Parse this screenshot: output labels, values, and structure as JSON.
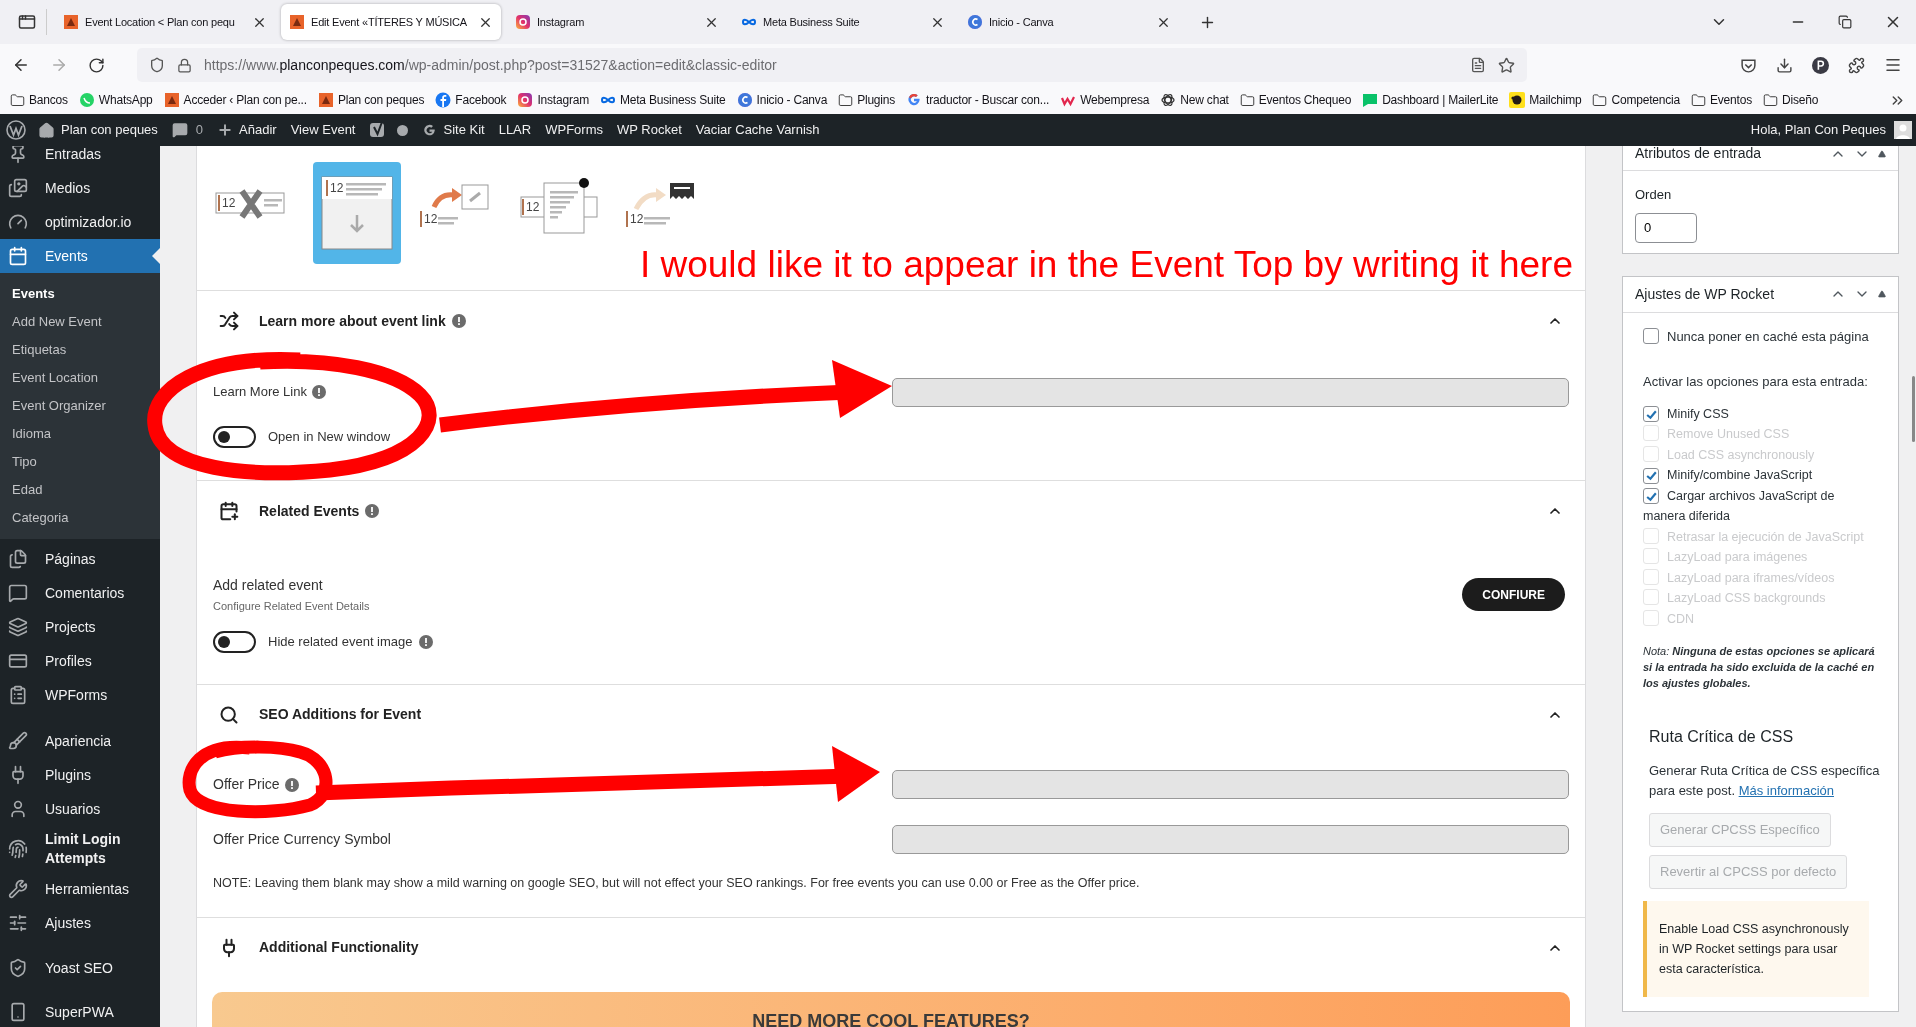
{
  "browser": {
    "tabs": [
      {
        "title": "Event Location < Plan con pequ",
        "kind": "site",
        "selected": false
      },
      {
        "title": "Edit Event «TÍTERES Y MÚSICA",
        "kind": "site",
        "selected": true
      },
      {
        "title": "Instagram",
        "kind": "instagram",
        "selected": false
      },
      {
        "title": "Meta Business Suite",
        "kind": "meta",
        "selected": false
      },
      {
        "title": "Inicio - Canva",
        "kind": "canva",
        "selected": false
      }
    ],
    "url": {
      "scheme": "https://www.",
      "domain": "planconpeques.com",
      "path": "/wp-admin/post.php?post=31527&action=edit&classic-editor"
    },
    "bookmarks": [
      {
        "label": "Bancos",
        "kind": "folder"
      },
      {
        "label": "WhatsApp",
        "kind": "whatsapp"
      },
      {
        "label": "Acceder ‹ Plan con pe...",
        "kind": "site"
      },
      {
        "label": "Plan con peques",
        "kind": "site"
      },
      {
        "label": "Facebook",
        "kind": "facebook"
      },
      {
        "label": "Instagram",
        "kind": "instagram"
      },
      {
        "label": "Meta Business Suite",
        "kind": "meta"
      },
      {
        "label": "Inicio - Canva",
        "kind": "canva"
      },
      {
        "label": "Plugins",
        "kind": "folder"
      },
      {
        "label": "traductor - Buscar con...",
        "kind": "google"
      },
      {
        "label": "Webempresa",
        "kind": "webempresa"
      },
      {
        "label": "New chat",
        "kind": "chat"
      },
      {
        "label": "Eventos Chequeo",
        "kind": "folder"
      },
      {
        "label": "Dashboard | MailerLite",
        "kind": "mailerlite"
      },
      {
        "label": "Mailchimp",
        "kind": "mailchimp"
      },
      {
        "label": "Competencia",
        "kind": "folder"
      },
      {
        "label": "Eventos",
        "kind": "folder"
      },
      {
        "label": "Diseño",
        "kind": "folder"
      }
    ]
  },
  "admin_bar": {
    "items": [
      {
        "kind": "home",
        "label": "Plan con peques"
      },
      {
        "kind": "comments",
        "label": "0"
      },
      {
        "kind": "add",
        "label": "Añadir"
      },
      {
        "kind": "text",
        "label": "View Event"
      },
      {
        "kind": "yoast"
      },
      {
        "kind": "dot"
      },
      {
        "kind": "google",
        "label": "Site Kit"
      },
      {
        "kind": "text",
        "label": "LLAR"
      },
      {
        "kind": "text",
        "label": "WPForms"
      },
      {
        "kind": "text",
        "label": "WP Rocket"
      },
      {
        "kind": "text",
        "label": "Vaciar Cache Varnish"
      }
    ],
    "greeting": "Hola, Plan Con Peques"
  },
  "sidebar": {
    "items": [
      {
        "label": "Entradas",
        "selected": false
      },
      {
        "label": "Medios",
        "selected": false
      },
      {
        "label": "optimizador.io",
        "selected": false
      },
      {
        "label": "Events",
        "selected": true,
        "children": [
          {
            "label": "Events",
            "selected": true
          },
          {
            "label": "Add New Event",
            "selected": false
          },
          {
            "label": "Etiquetas",
            "selected": false
          },
          {
            "label": "Event Location",
            "selected": false
          },
          {
            "label": "Event Organizer",
            "selected": false
          },
          {
            "label": "Idioma",
            "selected": false
          },
          {
            "label": "Tipo",
            "selected": false
          },
          {
            "label": "Edad",
            "selected": false
          },
          {
            "label": "Categoria",
            "selected": false
          }
        ]
      },
      {
        "label": "Páginas",
        "selected": false
      },
      {
        "label": "Comentarios",
        "selected": false
      },
      {
        "label": "Projects",
        "selected": false
      },
      {
        "label": "Profiles",
        "selected": false
      },
      {
        "label": "WPForms",
        "selected": false
      },
      {
        "label": "Apariencia",
        "selected": false
      },
      {
        "label": "Plugins",
        "selected": false
      },
      {
        "label": "Usuarios",
        "selected": false
      },
      {
        "label": "Limit Login Attempts",
        "selected": false
      },
      {
        "label": "Herramientas",
        "selected": false
      },
      {
        "label": "Ajustes",
        "selected": false
      },
      {
        "label": "Yoast SEO",
        "selected": false
      },
      {
        "label": "SuperPWA",
        "selected": false
      }
    ]
  },
  "event_editor": {
    "layout_options": [
      {
        "date": "12",
        "selected": false
      },
      {
        "date": "12",
        "selected": true
      },
      {
        "date": "12",
        "selected": false
      },
      {
        "date": "12",
        "selected": false
      },
      {
        "date": "12",
        "selected": false
      }
    ],
    "annotation": "I would like it to appear in the Event Top by writing it here",
    "sections": [
      {
        "kind": "link",
        "title": "Learn more about event link",
        "expanded": true,
        "field_label": "Learn More Link",
        "toggle": {
          "label": "Open in New window",
          "on": false
        }
      },
      {
        "kind": "related",
        "title": "Related Events",
        "expanded": true,
        "add_label": "Add related event",
        "add_hint": "Configure Related Event Details",
        "button": "CONFIURE",
        "toggle": {
          "label": "Hide related event image",
          "on": false
        }
      },
      {
        "kind": "seo",
        "title": "SEO Additions for Event",
        "expanded": true,
        "fields": [
          {
            "label": "Offer Price",
            "info": true
          },
          {
            "label": "Offer Price Currency Symbol",
            "info": false
          }
        ],
        "note": "NOTE: Leaving them blank may show a mild warning on google SEO, but will not effect your SEO rankings. For free events you can use 0.00 or Free as the Offer price."
      },
      {
        "kind": "functionality",
        "title": "Additional Functionality",
        "expanded": true,
        "banner": "NEED MORE COOL FEATURES?"
      }
    ]
  },
  "attributes_box": {
    "title": "Atributos de entrada",
    "order_label": "Orden",
    "order_value": "0"
  },
  "wp_rocket": {
    "title": "Ajustes de WP Rocket",
    "never_cache": {
      "label": "Nunca poner en caché esta página",
      "checked": false
    },
    "options_heading": "Activar las opciones para esta entrada:",
    "options": [
      {
        "label": "Minify CSS",
        "checked": true,
        "disabled": false
      },
      {
        "label": "Remove Unused CSS",
        "checked": false,
        "disabled": true
      },
      {
        "label": "Load CSS asynchronously",
        "checked": false,
        "disabled": true
      },
      {
        "label": "Minify/combine JavaScript",
        "checked": true,
        "disabled": false
      },
      {
        "label": "Cargar archivos JavaScript de manera diferida",
        "checked": true,
        "disabled": false
      },
      {
        "label": "Retrasar la ejecución de JavaScript",
        "checked": false,
        "disabled": true
      },
      {
        "label": "LazyLoad para imágenes",
        "checked": false,
        "disabled": true
      },
      {
        "label": "LazyLoad para iframes/vídeos",
        "checked": false,
        "disabled": true
      },
      {
        "label": "LazyLoad CSS backgrounds",
        "checked": false,
        "disabled": true
      },
      {
        "label": "CDN",
        "checked": false,
        "disabled": true
      }
    ],
    "note": "Nota: **Ninguna de estas opciones se aplicará si la entrada ha sido excluida de la caché en los ajustes globales.**",
    "critical_css": {
      "heading": "Ruta Crítica de CSS",
      "text": "Generar Ruta Crítica de CSS específica para este post.",
      "link": "Más información",
      "buttons": [
        {
          "label": "Generar CPCSS Específico",
          "disabled": true
        },
        {
          "label": "Revertir al CPCSS por defecto",
          "disabled": true
        }
      ],
      "notice": "Enable Load CSS asynchronously in WP Rocket settings para usar esta característica."
    }
  }
}
